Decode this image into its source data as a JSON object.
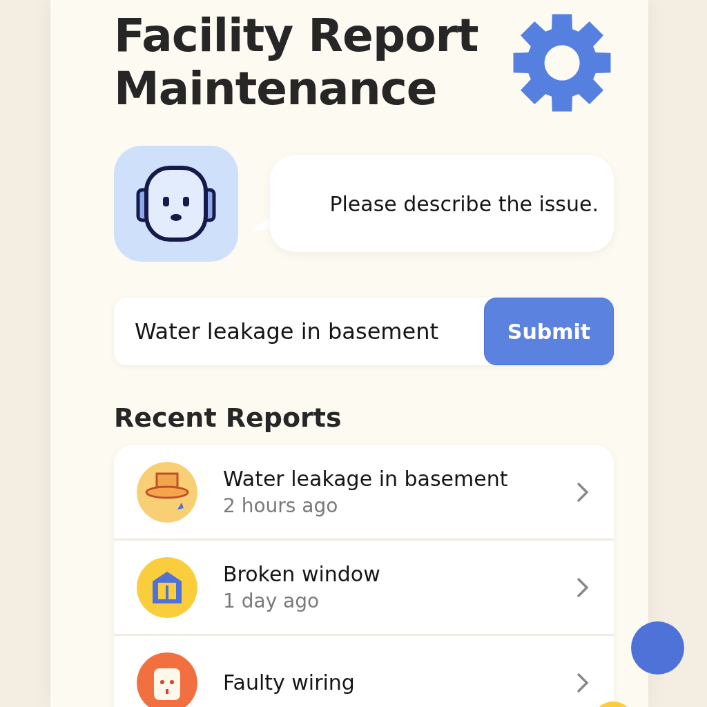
{
  "header": {
    "title": "Facility Report Maintenance"
  },
  "assistant": {
    "message": "Please describe the issue."
  },
  "report_form": {
    "value": "Water leakage in basement",
    "button": "Submit"
  },
  "recent": {
    "heading": "Recent Reports",
    "items": [
      {
        "kind": "leak",
        "title": "Water leakage in basement",
        "time": "2 hours ago"
      },
      {
        "kind": "window",
        "title": "Broken window",
        "time": "1 day ago"
      },
      {
        "kind": "wiring",
        "title": "Faulty wiring"
      }
    ]
  }
}
